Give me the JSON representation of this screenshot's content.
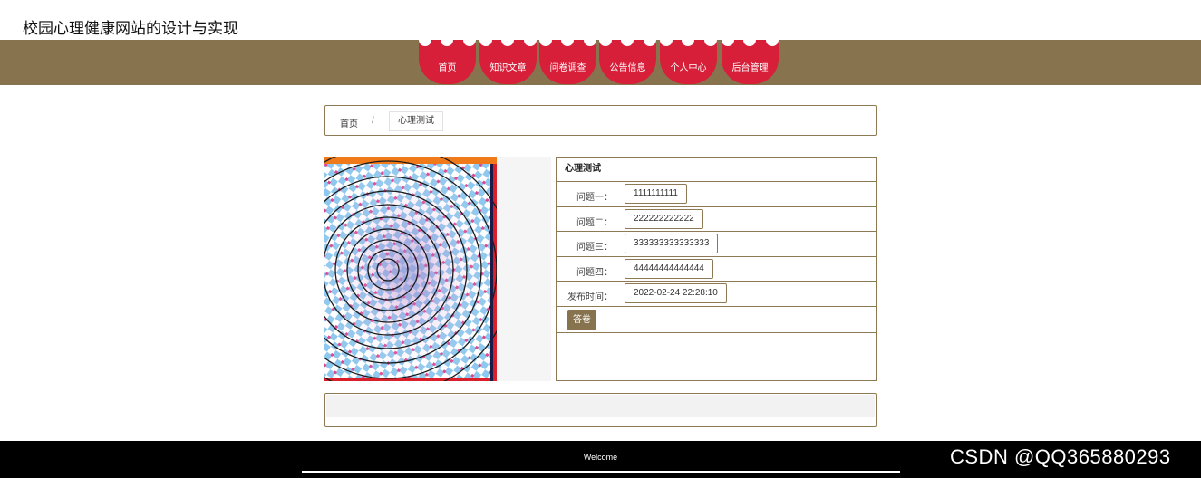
{
  "site": {
    "title": "校园心理健康网站的设计与实现"
  },
  "nav": {
    "items": [
      {
        "label": "首页"
      },
      {
        "label": "知识文章"
      },
      {
        "label": "问卷调查"
      },
      {
        "label": "公告信息"
      },
      {
        "label": "个人中心"
      },
      {
        "label": "后台管理"
      }
    ]
  },
  "breadcrumb": {
    "home": "首页",
    "separator": "/",
    "current": "心理测试"
  },
  "image": {
    "icon": "spiral-illusion-image"
  },
  "detail": {
    "title": "心理测试",
    "rows": [
      {
        "label": "问题一：",
        "value": "1111111111"
      },
      {
        "label": "问题二：",
        "value": "222222222222"
      },
      {
        "label": "问题三：",
        "value": "333333333333333"
      },
      {
        "label": "问题四：",
        "value": "44444444444444"
      },
      {
        "label": "发布时间：",
        "value": "2022-02-24 22:28:10"
      }
    ],
    "answer_button": "答卷"
  },
  "footer": {
    "text": "Welcome"
  },
  "watermark": "CSDN @QQ365880293",
  "colors": {
    "accent": "#87744f",
    "nav_red": "#d71f39",
    "footer": "#000000"
  }
}
